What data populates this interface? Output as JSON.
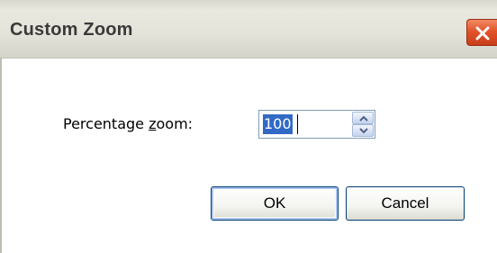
{
  "window": {
    "title": "Custom Zoom",
    "close_icon": "close-x-icon",
    "accent_color": "#e1542a"
  },
  "form": {
    "zoom_label_before": "Percentage ",
    "zoom_label_mnemonic": "z",
    "zoom_label_after": "oom:",
    "zoom_value": "100",
    "spin_up_icon": "chevron-up-icon",
    "spin_down_icon": "chevron-down-icon"
  },
  "buttons": {
    "ok_label": "OK",
    "cancel_label": "Cancel"
  }
}
